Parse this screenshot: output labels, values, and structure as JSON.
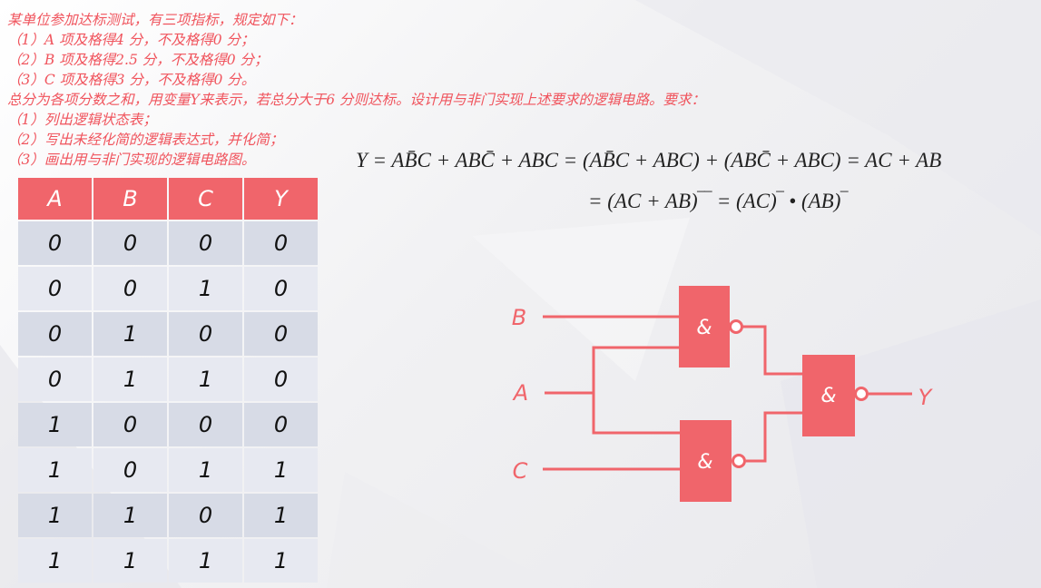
{
  "problem": {
    "lines": [
      "某单位参加达标测试，有三项指标，规定如下：",
      "（1）A 项及格得4 分，不及格得0 分；",
      "（2）B 项及格得2.5 分，不及格得0 分；",
      "（3）C 项及格得3 分，不及格得0 分。",
      "总分为各项分数之和，用变量Y来表示，若总分大于6 分则达标。设计用与非门实现上述要求的逻辑电路。要求：",
      "（1）列出逻辑状态表；",
      "（2）写出未经化简的逻辑表达式，并化简；",
      "（3）画出用与非门实现的逻辑电路图。"
    ]
  },
  "truth_table": {
    "headers": [
      "A",
      "B",
      "C",
      "Y"
    ],
    "rows": [
      [
        "0",
        "0",
        "0",
        "0"
      ],
      [
        "0",
        "0",
        "1",
        "0"
      ],
      [
        "0",
        "1",
        "0",
        "0"
      ],
      [
        "0",
        "1",
        "1",
        "0"
      ],
      [
        "1",
        "0",
        "0",
        "0"
      ],
      [
        "1",
        "0",
        "1",
        "1"
      ],
      [
        "1",
        "1",
        "0",
        "1"
      ],
      [
        "1",
        "1",
        "1",
        "1"
      ]
    ]
  },
  "equation": {
    "line1": "Y = AB̄C + ABC̄ + ABC = (AB̄C + ABC) + (ABC̄ + ABC) = AC + AB",
    "line2": "= (AC + AB)‾‾ = (AC)‾ • (AB)‾"
  },
  "circuit": {
    "inputs": [
      "B",
      "A",
      "C"
    ],
    "output": "Y",
    "gate_symbol": "&",
    "gates": [
      "nand-top",
      "nand-bottom",
      "nand-output"
    ],
    "color": "#f0656b"
  }
}
